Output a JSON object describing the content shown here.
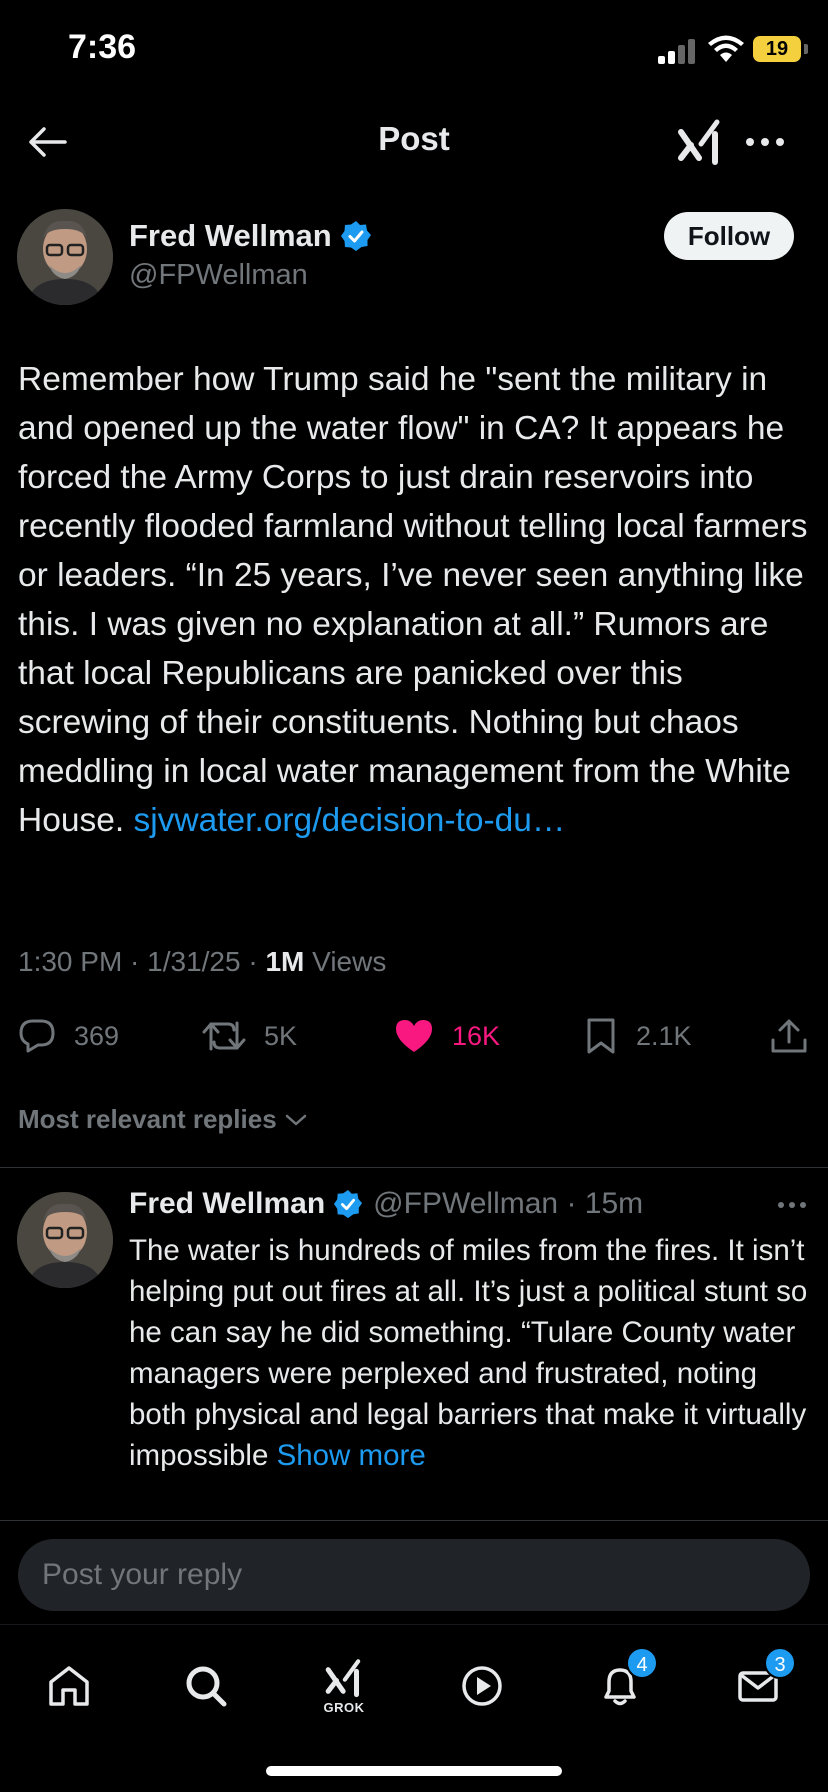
{
  "status_bar": {
    "time": "7:36",
    "battery": "19"
  },
  "header": {
    "title": "Post"
  },
  "author": {
    "name": "Fred Wellman",
    "handle": "@FPWellman",
    "follow_label": "Follow"
  },
  "tweet": {
    "text": "Remember how Trump said he \"sent the military in and opened up the water flow\" in CA? It appears he forced the Army Corps to just drain reservoirs into recently flooded farmland without telling local farmers or leaders. “In 25 years, I’ve never seen anything like this. I was given no explanation at all.” Rumors are that local Republicans are panicked over this screwing of their constituents. Nothing but chaos meddling in local water management from the White House. ",
    "link": "sjvwater.org/decision-to-du…",
    "time": "1:30 PM · 1/31/25 · ",
    "views_count": "1M",
    "views_label": " Views"
  },
  "actions": {
    "replies": "369",
    "reposts": "5K",
    "likes": "16K",
    "bookmarks": "2.1K"
  },
  "replies_sort": "Most relevant replies",
  "reply": {
    "name": "Fred Wellman",
    "handle": "@FPWellman · 15m",
    "text": "The water is hundreds of miles from the fires. It isn’t helping put out fires at all. It’s just a political stunt so he can say he did something. “Tulare County water managers were perplexed and frustrated, noting both physical and legal barriers that make it virtually impossible ",
    "show_more": "Show more"
  },
  "composer": {
    "placeholder": "Post your reply"
  },
  "nav": {
    "grok_label": "GROK",
    "notifications_badge": "4",
    "messages_badge": "3"
  },
  "colors": {
    "accent": "#1d9bf0",
    "like": "#f91880",
    "muted": "#71767b",
    "background": "#000000"
  }
}
